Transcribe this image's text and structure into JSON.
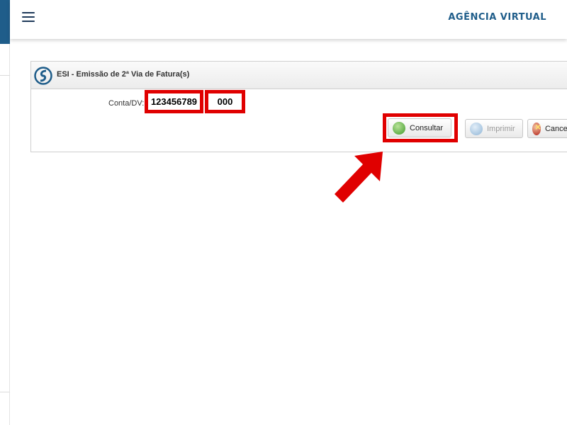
{
  "header": {
    "brand_title": "AGÊNCIA VIRTUAL",
    "menu_icon": "hamburger-menu-icon"
  },
  "panel": {
    "title": "ESI - Emissão de 2ª Via de Fatura(s)",
    "logo_icon": "esi-logo-icon"
  },
  "form": {
    "account_label": "Conta/DV:",
    "account_value": "123456789",
    "dv_value": "000"
  },
  "buttons": {
    "consultar_label": "Consultar",
    "imprimir_label": "Imprimir",
    "cancelar_label": "Cancelar"
  },
  "colors": {
    "accent": "#1f5d8a",
    "highlight": "#e00000"
  }
}
